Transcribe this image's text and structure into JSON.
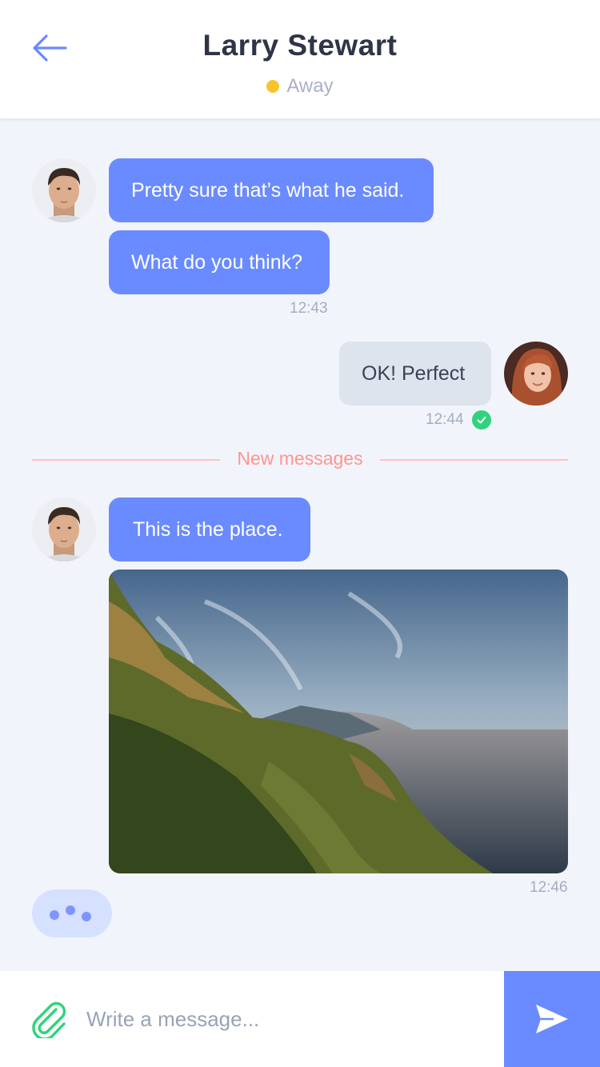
{
  "header": {
    "contact_name": "Larry Stewart",
    "status_label": "Away",
    "status_color": "#f9c42a",
    "back_icon": "arrow-left-icon"
  },
  "messages": [
    {
      "from": "contact",
      "text": "Pretty sure that’s what he said."
    },
    {
      "from": "contact",
      "text": "What do you think?",
      "time": "12:43"
    },
    {
      "from": "me",
      "text": "OK! Perfect",
      "time": "12:44",
      "read": true
    },
    {
      "from": "contact",
      "text": "This is the place."
    },
    {
      "from": "contact",
      "type": "image",
      "time": "12:46"
    }
  ],
  "divider": {
    "label": "New messages"
  },
  "typing_indicator": {
    "active": true
  },
  "composer": {
    "placeholder": "Write a message...",
    "value": "",
    "attach_icon": "paperclip-icon",
    "send_icon": "send-icon"
  },
  "colors": {
    "accent": "#6a8bff",
    "outgoing_bubble": "#dde4ed",
    "read_check": "#2ed47a",
    "divider": "#ff958b"
  }
}
